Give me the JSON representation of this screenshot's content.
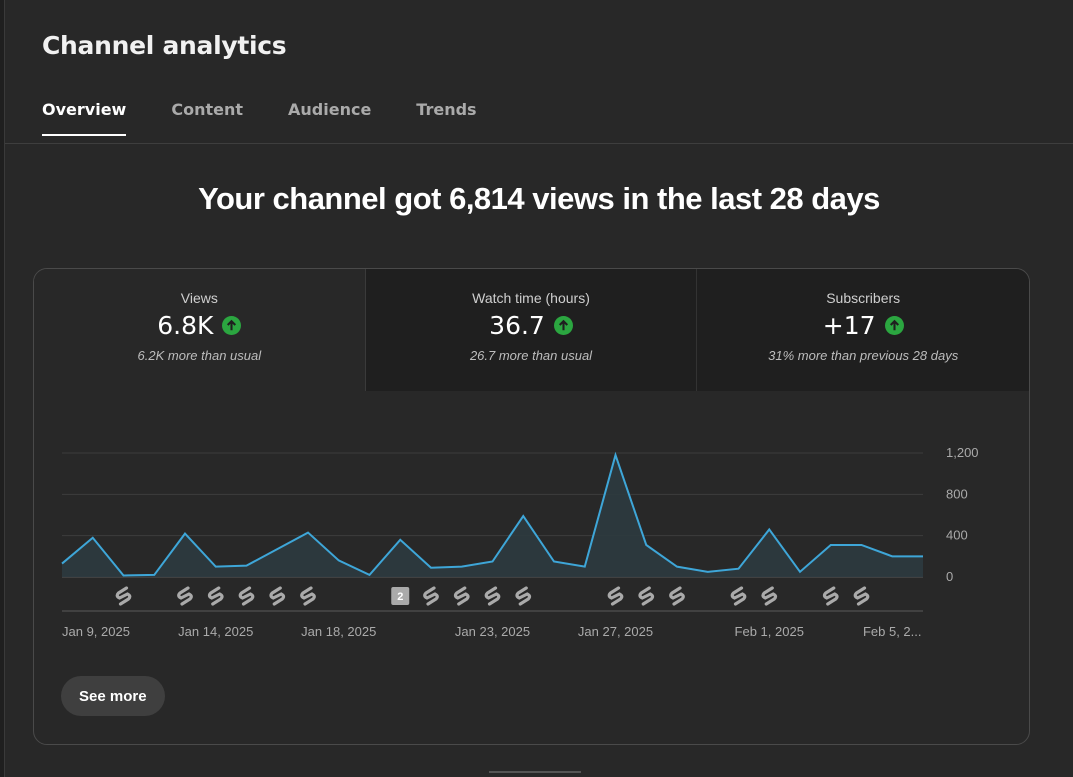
{
  "page": {
    "title": "Channel analytics"
  },
  "tabs": [
    {
      "label": "Overview",
      "active": true
    },
    {
      "label": "Content",
      "active": false
    },
    {
      "label": "Audience",
      "active": false
    },
    {
      "label": "Trends",
      "active": false
    }
  ],
  "headline": "Your channel got 6,814 views in the last 28 days",
  "metrics": [
    {
      "label": "Views",
      "value": "6.8K",
      "note": "6.2K more than usual",
      "trend": "up"
    },
    {
      "label": "Watch time (hours)",
      "value": "36.7",
      "note": "26.7 more than usual",
      "trend": "up"
    },
    {
      "label": "Subscribers",
      "value": "+17",
      "note": "31% more than previous 28 days",
      "trend": "up"
    }
  ],
  "colors": {
    "line": "#3ea6d8",
    "up": "#2ba640",
    "area": "#2c3a3f"
  },
  "see_more_label": "See more",
  "chart_data": {
    "type": "area",
    "x": [
      "Jan 8, 2025",
      "Jan 9, 2025",
      "Jan 10, 2025",
      "Jan 11, 2025",
      "Jan 12, 2025",
      "Jan 13, 2025",
      "Jan 14, 2025",
      "Jan 15, 2025",
      "Jan 16, 2025",
      "Jan 17, 2025",
      "Jan 18, 2025",
      "Jan 19, 2025",
      "Jan 20, 2025",
      "Jan 21, 2025",
      "Jan 22, 2025",
      "Jan 23, 2025",
      "Jan 24, 2025",
      "Jan 25, 2025",
      "Jan 26, 2025",
      "Jan 27, 2025",
      "Jan 28, 2025",
      "Jan 29, 2025",
      "Jan 30, 2025",
      "Jan 31, 2025",
      "Feb 1, 2025",
      "Feb 2, 2025",
      "Feb 3, 2025",
      "Feb 4, 2025",
      "Feb 5, 2025"
    ],
    "values": [
      130,
      380,
      15,
      20,
      420,
      100,
      110,
      270,
      430,
      160,
      20,
      360,
      90,
      100,
      150,
      590,
      150,
      100,
      1180,
      310,
      100,
      50,
      80,
      460,
      50,
      310,
      310,
      200,
      200
    ],
    "tick_labels": [
      "Jan 9, 2025",
      "Jan 14, 2025",
      "Jan 18, 2025",
      "Jan 23, 2025",
      "Jan 27, 2025",
      "Feb 1, 2025",
      "Feb 5, 2..."
    ],
    "yticks": [
      "1,200",
      "800",
      "400",
      "0"
    ],
    "ylim": [
      0,
      1200
    ],
    "upload_markers": [
      {
        "label": ""
      },
      {
        "label": ""
      },
      {
        "label": ""
      },
      {
        "label": ""
      },
      {
        "label": ""
      },
      {
        "label": ""
      },
      {
        "label": "2"
      },
      {
        "label": ""
      },
      {
        "label": ""
      },
      {
        "label": ""
      },
      {
        "label": ""
      },
      {
        "label": ""
      },
      {
        "label": ""
      },
      {
        "label": ""
      },
      {
        "label": ""
      },
      {
        "label": ""
      },
      {
        "label": ""
      },
      {
        "label": ""
      }
    ]
  }
}
